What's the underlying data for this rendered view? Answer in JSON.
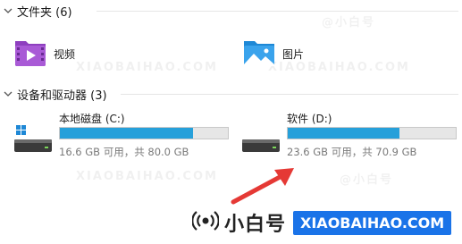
{
  "sections": {
    "folders": {
      "label": "文件夹 (6)"
    },
    "drives": {
      "label": "设备和驱动器 (3)"
    }
  },
  "folders": [
    {
      "label": "视频",
      "icon": "video-folder-icon"
    },
    {
      "label": "图片",
      "icon": "pictures-folder-icon"
    }
  ],
  "drives": [
    {
      "label": "本地磁盘 (C:)",
      "stats": "16.6 GB 可用，共 80.0 GB",
      "used_fraction": 0.7925,
      "icon": "windows-drive-icon"
    },
    {
      "label": "软件 (D:)",
      "stats": "23.6 GB 可用，共 70.9 GB",
      "used_fraction": 0.6671,
      "icon": "drive-icon"
    }
  ],
  "watermark": {
    "brand": "小白号",
    "site": "XIAOBAIHAO.COM",
    "faint": [
      "XIAOBAIHAO.COM",
      "@小白号"
    ]
  },
  "colors": {
    "bar_fill": "#26a0da",
    "bar_empty": "#e6e6e6",
    "arrow": "#e53935",
    "site_badge": "#1a73e8"
  }
}
